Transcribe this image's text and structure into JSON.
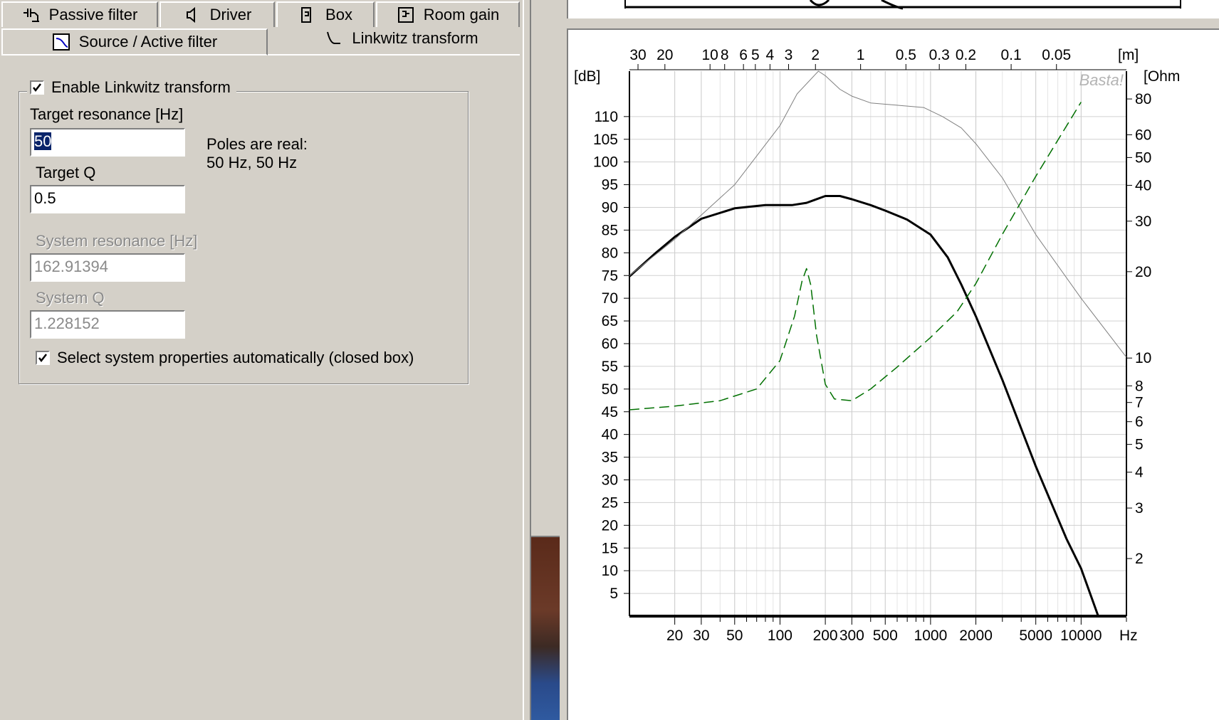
{
  "tabs": {
    "passive": "Passive filter",
    "driver": "Driver",
    "box": "Box",
    "room": "Room gain",
    "source": "Source / Active filter",
    "linkwitz": "Linkwitz transform"
  },
  "linkwitz": {
    "enable_label": "Enable Linkwitz transform",
    "enable_checked": true,
    "target_resonance_label": "Target resonance [Hz]",
    "target_resonance_value": "50",
    "target_q_label": "Target Q",
    "target_q_value": "0.5",
    "poles_line1": "Poles are real:",
    "poles_line2": "50 Hz, 50 Hz",
    "system_resonance_label": "System resonance [Hz]",
    "system_resonance_value": "162.91394",
    "system_q_label": "System Q",
    "system_q_value": "1.228152",
    "auto_label": "Select system properties automatically (closed box)",
    "auto_checked": true
  },
  "chart_data": {
    "type": "line",
    "watermark": "Basta!",
    "x_unit": "Hz",
    "ylabel_left": "[dB]",
    "ylabel_right": "[Ohm",
    "top_unit": "[m]",
    "x_scale": "log",
    "xlim": [
      10,
      20000
    ],
    "ylim_left": [
      0,
      120
    ],
    "y2_scale": "log",
    "ylim_right": [
      1.26,
      100
    ],
    "x_tick_labels": [
      20,
      30,
      50,
      100,
      200,
      300,
      500,
      1000,
      2000,
      5000,
      10000
    ],
    "y_tick_labels": [
      5,
      10,
      15,
      20,
      25,
      30,
      35,
      40,
      45,
      50,
      55,
      60,
      65,
      70,
      75,
      80,
      85,
      90,
      95,
      100,
      105,
      110
    ],
    "y2_tick_labels": [
      2,
      3,
      4,
      5,
      6,
      7,
      8,
      10,
      20,
      30,
      40,
      50,
      60,
      80
    ],
    "top_tick_labels": [
      "30",
      "20",
      "10",
      "8",
      "6",
      "5",
      "4",
      "3",
      "2",
      "1",
      "0.5",
      "0.3",
      "0.2",
      "0.1",
      "0.05"
    ],
    "top_tick_hz": [
      11.4,
      17.2,
      34.3,
      42.9,
      57.2,
      68.6,
      85.8,
      114,
      172,
      343,
      686,
      1143,
      1715,
      3430,
      6860
    ],
    "grid": true,
    "series": [
      {
        "color": "#000000",
        "style": "thick",
        "points": [
          [
            10,
            74.8
          ],
          [
            15,
            80
          ],
          [
            20,
            83.5
          ],
          [
            30,
            87.5
          ],
          [
            50,
            89.8
          ],
          [
            80,
            90.5
          ],
          [
            120,
            90.5
          ],
          [
            150,
            91
          ],
          [
            200,
            92.5
          ],
          [
            250,
            92.5
          ],
          [
            300,
            91.8
          ],
          [
            400,
            90.5
          ],
          [
            500,
            89.3
          ],
          [
            700,
            87.3
          ],
          [
            1000,
            84
          ],
          [
            1300,
            79
          ],
          [
            1600,
            73
          ],
          [
            2000,
            66
          ],
          [
            3000,
            52
          ],
          [
            5000,
            33
          ],
          [
            8000,
            17
          ],
          [
            10000,
            10.5
          ],
          [
            13000,
            0
          ],
          [
            20000,
            0
          ]
        ]
      },
      {
        "color": "#808080",
        "style": "thin",
        "points": [
          [
            10,
            75
          ],
          [
            20,
            83
          ],
          [
            50,
            95
          ],
          [
            100,
            108
          ],
          [
            130,
            115
          ],
          [
            180,
            120
          ],
          [
            200,
            119
          ],
          [
            250,
            116
          ],
          [
            300,
            114.5
          ],
          [
            400,
            113
          ],
          [
            600,
            112.5
          ],
          [
            900,
            112
          ],
          [
            1200,
            110
          ],
          [
            1600,
            107.5
          ],
          [
            2000,
            104
          ],
          [
            3000,
            96.5
          ],
          [
            5000,
            84
          ],
          [
            10000,
            70
          ],
          [
            20000,
            57
          ]
        ]
      },
      {
        "color": "#007000",
        "style": "dashed",
        "axis": "right",
        "points": [
          [
            10,
            6.6
          ],
          [
            20,
            6.8
          ],
          [
            40,
            7.1
          ],
          [
            70,
            7.8
          ],
          [
            100,
            9.8
          ],
          [
            125,
            14
          ],
          [
            140,
            18.5
          ],
          [
            150,
            20.5
          ],
          [
            160,
            18
          ],
          [
            175,
            12
          ],
          [
            200,
            8.1
          ],
          [
            230,
            7.2
          ],
          [
            300,
            7.1
          ],
          [
            400,
            7.8
          ],
          [
            600,
            9.3
          ],
          [
            1000,
            11.8
          ],
          [
            1500,
            14.5
          ],
          [
            2000,
            18.2
          ],
          [
            3000,
            27
          ],
          [
            5000,
            43
          ],
          [
            10000,
            78
          ]
        ]
      }
    ]
  }
}
